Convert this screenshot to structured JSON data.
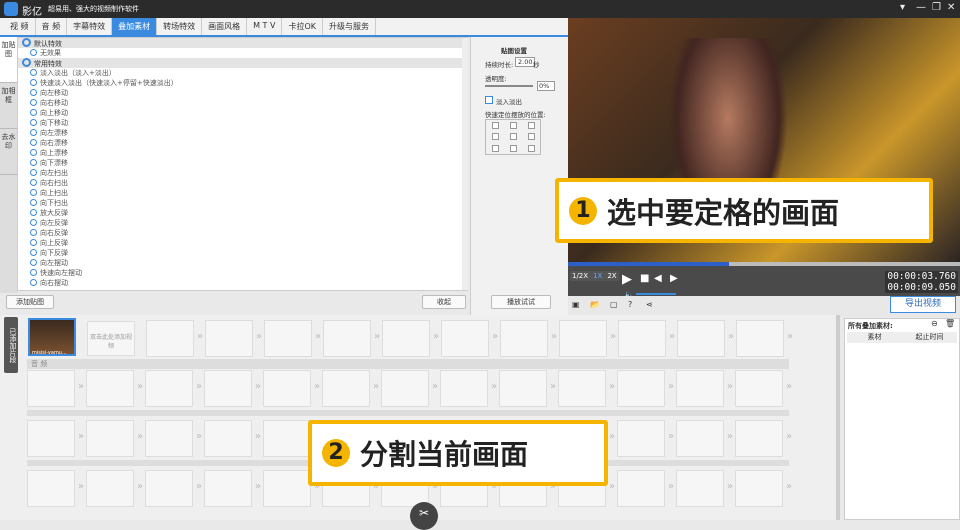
{
  "app": {
    "name": "影亿",
    "slogan": "超易用、强大的视频制作软件"
  },
  "tabs": [
    "视 频",
    "音 频",
    "字幕特效",
    "叠加素材",
    "转场特效",
    "画面风格",
    "M T V",
    "卡拉OK",
    "升级与服务"
  ],
  "side_tabs": [
    "加贴图",
    "加相框",
    "去水印"
  ],
  "groups": [
    {
      "label": "默认特效",
      "items": [
        "无效果"
      ]
    },
    {
      "label": "常用特效",
      "items": [
        "淡入淡出（淡入+淡出）",
        "快速淡入淡出（快速淡入+停留+快速淡出）",
        "向左移动",
        "向右移动",
        "向上移动",
        "向下移动",
        "向左漂移",
        "向右漂移",
        "向上漂移",
        "向下漂移",
        "向左扫出",
        "向右扫出",
        "向上扫出",
        "向下扫出",
        "放大反弹",
        "向左反弹",
        "向右反弹",
        "向上反弹",
        "向下反弹",
        "向左摆动",
        "快速向左摆动",
        "向右摆动"
      ]
    }
  ],
  "buttons": {
    "add_sticker": "添加贴图",
    "collapse": "收起",
    "play_test": "播放试试",
    "export": "导出视频"
  },
  "settings": {
    "title": "贴图设置",
    "duration_label": "持续时长:",
    "duration": "2.00",
    "sec": "秒",
    "opacity_label": "透明度:",
    "opacity": "0%",
    "fade": "淡入淡出",
    "pos_label": "快速定位摆放的位置:"
  },
  "player": {
    "speeds": [
      "1/2X",
      "1X",
      "2X"
    ],
    "current": "00:00:03.760",
    "total": "00:00:09.050",
    "progress": 0.41
  },
  "timeline": {
    "side_label": "已添加片段",
    "clip_name": "misisi-vamu...",
    "placeholder": "双击此处添加视频",
    "audio": "音 频"
  },
  "materials": {
    "title": "所有叠加素材:",
    "cols": [
      "素材",
      "起止时间"
    ]
  },
  "callouts": [
    {
      "num": "1",
      "text": "选中要定格的画面"
    },
    {
      "num": "2",
      "text": "分割当前画面"
    }
  ]
}
